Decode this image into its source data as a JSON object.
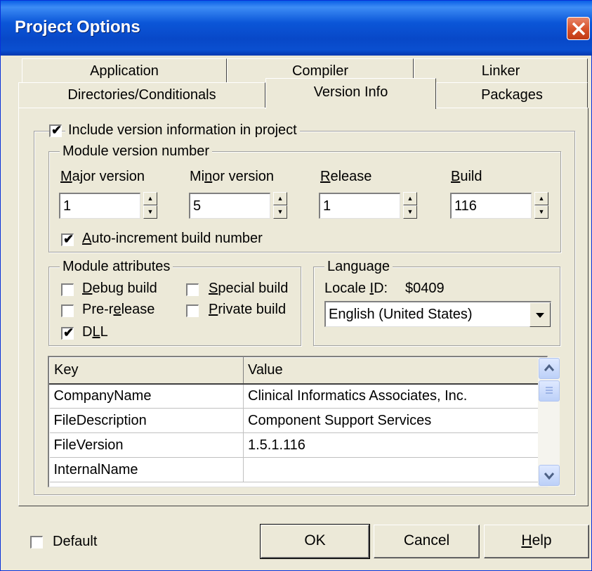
{
  "window": {
    "title": "Project Options"
  },
  "tabs_row1": [
    "Application",
    "Compiler",
    "Linker"
  ],
  "tabs_row2": [
    "Directories/Conditionals",
    "Version Info",
    "Packages"
  ],
  "include_version": {
    "label": "Include version information in project",
    "checked": true
  },
  "module_version": {
    "legend": "Module version number",
    "fields": [
      {
        "label": "Major version",
        "value": "1"
      },
      {
        "label": "Minor version",
        "value": "5"
      },
      {
        "label": "Release",
        "value": "1"
      },
      {
        "label": "Build",
        "value": "116"
      }
    ],
    "auto_increment": {
      "label": "Auto-increment build number",
      "checked": true
    }
  },
  "module_attributes": {
    "legend": "Module attributes",
    "items": [
      {
        "label": "Debug build",
        "checked": false
      },
      {
        "label": "Special build",
        "checked": false
      },
      {
        "label": "Pre-release",
        "checked": false
      },
      {
        "label": "Private build",
        "checked": false
      },
      {
        "label": "DLL",
        "checked": true
      }
    ]
  },
  "language": {
    "legend": "Language",
    "locale_label": "Locale ID:",
    "locale_value": "$0409",
    "selected": "English (United States)"
  },
  "table": {
    "headers": [
      "Key",
      "Value"
    ],
    "rows": [
      {
        "key": "CompanyName",
        "value": "Clinical Informatics Associates, Inc."
      },
      {
        "key": "FileDescription",
        "value": "Component Support Services"
      },
      {
        "key": "FileVersion",
        "value": "1.5.1.116"
      },
      {
        "key": "InternalName",
        "value": ""
      }
    ]
  },
  "footer": {
    "default_label": "Default",
    "default_checked": false,
    "ok": "OK",
    "cancel": "Cancel",
    "help": "Help"
  }
}
